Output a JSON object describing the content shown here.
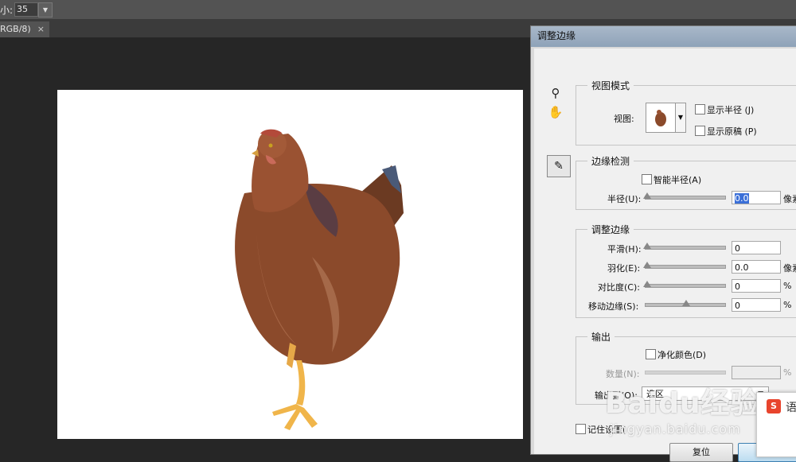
{
  "options_bar": {
    "size_label": "小:",
    "size_value": "35"
  },
  "document_tab": {
    "label": "RGB/8)",
    "close": "×"
  },
  "dialog": {
    "title": "调整边缘",
    "view_mode": {
      "title": "视图模式",
      "view_label": "视图:",
      "show_radius": "显示半径 (J)",
      "show_original": "显示原稿 (P)"
    },
    "edge_detection": {
      "title": "边缘检测",
      "smart_radius": "智能半径(A)",
      "radius_label": "半径(U):",
      "radius_value": "0.0",
      "radius_unit": "像素"
    },
    "adjust_edge": {
      "title": "调整边缘",
      "smooth_label": "平滑(H):",
      "smooth_value": "0",
      "feather_label": "羽化(E):",
      "feather_value": "0.0",
      "feather_unit": "像素",
      "contrast_label": "对比度(C):",
      "contrast_value": "0",
      "contrast_unit": "%",
      "shift_label": "移动边缘(S):",
      "shift_value": "0",
      "shift_unit": "%"
    },
    "output": {
      "title": "输出",
      "decontaminate": "净化颜色(D)",
      "amount_label": "数量(N):",
      "amount_unit": "%",
      "output_to_label": "输出到(O):",
      "output_to_value": "选区"
    },
    "remember": "记住设置(",
    "reset_button": "复位"
  },
  "ime_popup": {
    "icon": "S",
    "text": "语"
  },
  "watermark": {
    "brand": "Baidu经验",
    "url": "jingyan.baidu.com"
  },
  "colors": {
    "accent": "#3a6fd8",
    "chicken": "#8b4a2b",
    "leg": "#f0b54a"
  }
}
